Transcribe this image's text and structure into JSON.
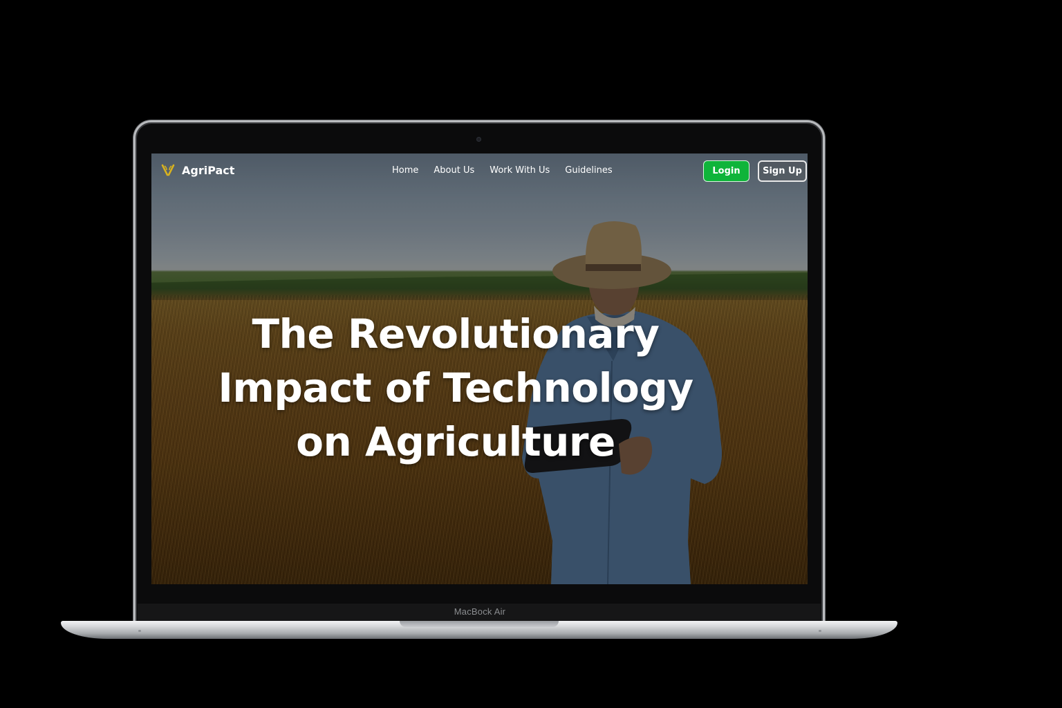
{
  "device": {
    "model_label": "MacBock Air"
  },
  "site": {
    "brand": "AgriPact",
    "brand_color": "#d8b21f",
    "nav": {
      "links": [
        {
          "label": "Home"
        },
        {
          "label": "About Us"
        },
        {
          "label": "Work With Us"
        },
        {
          "label": "Guidelines"
        }
      ],
      "login_label": "Login",
      "signup_label": "Sign Up",
      "login_color": "#0fb43a"
    },
    "hero": {
      "title_lines": [
        "The Revolutionary",
        "Impact of Technology",
        "on Agriculture"
      ]
    }
  }
}
